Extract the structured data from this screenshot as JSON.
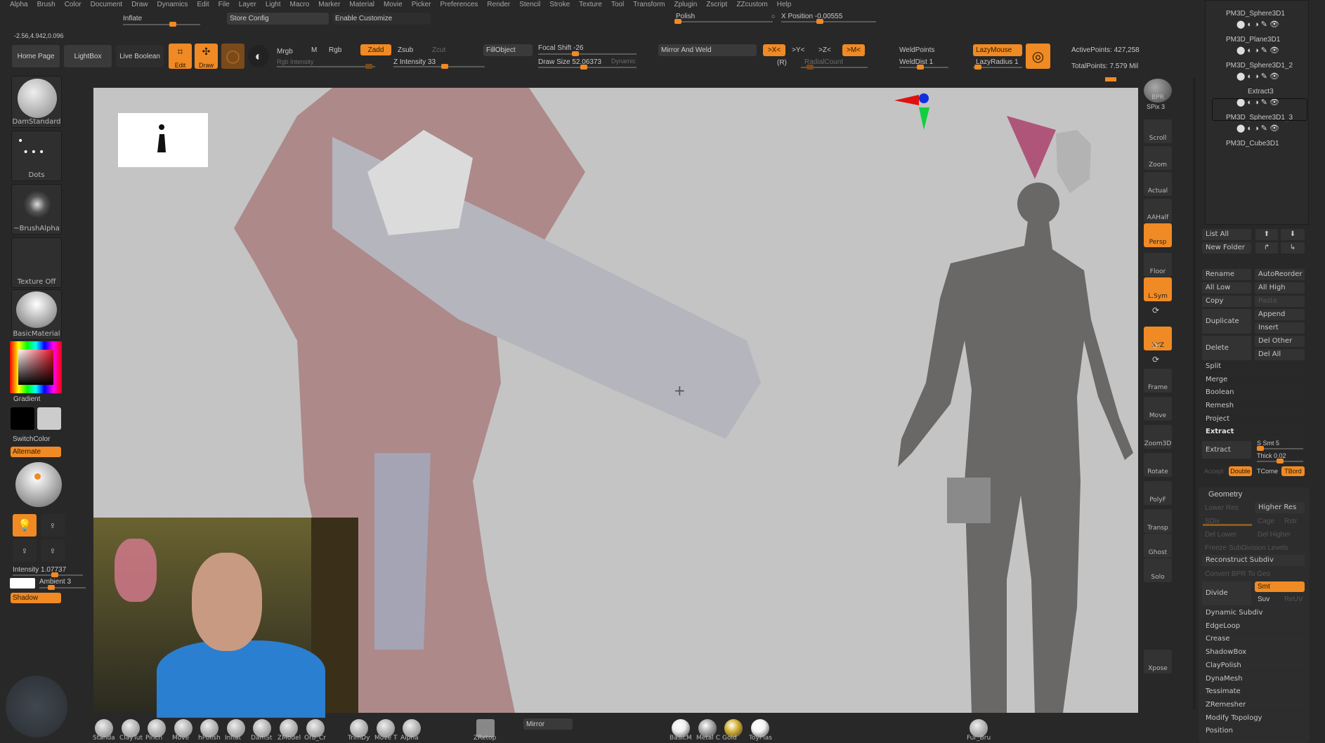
{
  "menu": [
    "Alpha",
    "Brush",
    "Color",
    "Document",
    "Draw",
    "Dynamics",
    "Edit",
    "File",
    "Layer",
    "Light",
    "Macro",
    "Marker",
    "Material",
    "Movie",
    "Picker",
    "Preferences",
    "Render",
    "Stencil",
    "Stroke",
    "Texture",
    "Tool",
    "Transform",
    "Zplugin",
    "Zscript",
    "ZZcustom",
    "Help"
  ],
  "top": {
    "inflate": "Inflate",
    "store_config": "Store Config",
    "enable_customize": "Enable Customize",
    "polish": "Polish",
    "x_position": "X Position -0.00555",
    "coords": "-2.56,4.942,0.096"
  },
  "toolbar": {
    "home_page": "Home Page",
    "lightbox": "LightBox",
    "live_boolean": "Live Boolean",
    "edit": "Edit",
    "draw": "Draw",
    "mrgb": "Mrgb",
    "m": "M",
    "rgb": "Rgb",
    "rgb_intensity": "Rgb Intensity",
    "zadd": "Zadd",
    "zsub": "Zsub",
    "zcut": "Zcut",
    "z_intensity": "Z Intensity 33",
    "fill_object": "FillObject",
    "focal_shift": "Focal Shift -26",
    "draw_size": "Draw Size 52.06373",
    "dynamic": "Dynamic",
    "mirror_weld": "Mirror And Weld",
    "x": ">X<",
    "y": ">Y<",
    "z": ">Z<",
    "m_sym": ">M<",
    "r": "(R)",
    "radial_count": "RadialCount",
    "weld_points": "WeldPoints",
    "weld_dist": "WeldDist 1",
    "lazy_mouse": "LazyMouse",
    "lazy_radius": "LazyRadius 1",
    "active_points": "ActivePoints: 427,258",
    "total_points": "TotalPoints: 7.579 Mil"
  },
  "left": {
    "brush": "DamStandard",
    "stroke": "Dots",
    "alpha": "~BrushAlpha",
    "texture": "Texture Off",
    "material": "BasicMaterial",
    "gradient": "Gradient",
    "switch_color": "SwitchColor",
    "alternate": "Alternate",
    "intensity": "Intensity 1.07737",
    "ambient": "Ambient 3",
    "shadow": "Shadow"
  },
  "shelf": [
    "BPR",
    "SPix 3",
    "Scroll",
    "Zoom",
    "Actual",
    "AAHalf",
    "Persp",
    "Floor",
    "L.Sym",
    "",
    "XYZ",
    "",
    "",
    "Frame",
    "Move",
    "Zoom3D",
    "Rotate",
    "PolyF",
    "Transp",
    "Ghost",
    "Solo",
    "Xpose"
  ],
  "subtools": [
    "PM3D_Sphere3D1",
    "PM3D_Plane3D1",
    "PM3D_Sphere3D1_2",
    "Extract3",
    "PM3D_Sphere3D1_3",
    "PM3D_Cube3D1"
  ],
  "subtool_ops": {
    "list_all": "List All",
    "new_folder": "New Folder",
    "rename": "Rename",
    "auto_reorder": "AutoReorder",
    "all_low": "All Low",
    "all_high": "All High",
    "copy": "Copy",
    "paste": "Paste",
    "duplicate": "Duplicate",
    "append": "Append",
    "insert": "Insert",
    "delete": "Delete",
    "del_other": "Del Other",
    "del_all": "Del All",
    "split": "Split",
    "merge": "Merge",
    "boolean": "Boolean",
    "remesh": "Remesh",
    "project": "Project",
    "extract_header": "Extract",
    "extract": "Extract",
    "s_smt": "S Smt 5",
    "thick": "Thick 0.02",
    "accept": "Accept",
    "double": "Double",
    "tcorner": "TCorne",
    "tborder": "TBord"
  },
  "geometry": {
    "title": "Geometry",
    "lower_res": "Lower Res",
    "higher_res": "Higher Res",
    "sdiv": "SDiv",
    "cage": "Cage",
    "rstr": "Rstr",
    "del_lower": "Del Lower",
    "del_higher": "Del Higher",
    "freeze": "Freeze SubDivision Levels",
    "reconstruct": "Reconstruct Subdiv",
    "convert_bpr": "Convert BPR To Geo",
    "divide": "Divide",
    "smt": "Smt",
    "suv": "Suv",
    "reuv": "ReUV",
    "items": [
      "Dynamic Subdiv",
      "EdgeLoop",
      "Crease",
      "ShadowBox",
      "ClayPolish",
      "DynaMesh",
      "Tessimate",
      "ZRemesher",
      "Modify Topology",
      "Position"
    ]
  },
  "bottom": {
    "brushes": [
      "Standa",
      "ClayTut",
      "Pinch",
      "Move",
      "hPolish",
      "Inflat",
      "DamSt",
      "ZModel",
      "Orb_Cr",
      "TrimDy",
      "Move T",
      "Alpha"
    ],
    "zretop": "ZRetop",
    "mirror": "Mirror",
    "materials": [
      "BasicM",
      "Metal C",
      "Gold",
      "ToyPlas"
    ],
    "fur": "Fur_Bru"
  },
  "colors": {
    "accent": "#f08a24",
    "panel": "#282828",
    "viewport": "#c4c4c4"
  }
}
